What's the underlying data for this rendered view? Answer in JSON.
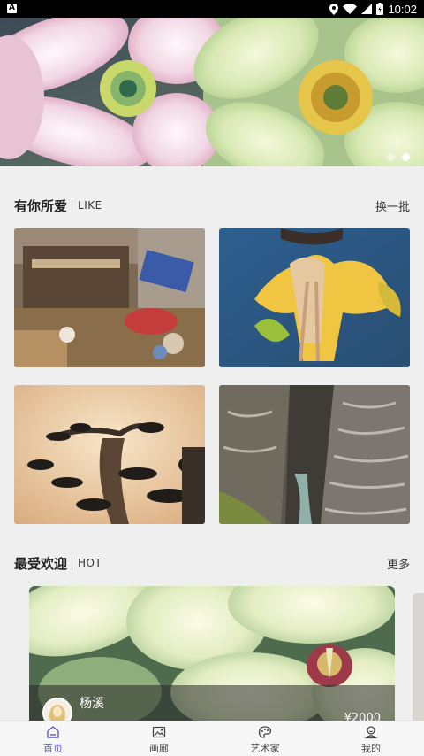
{
  "status_bar": {
    "time": "10:02",
    "app_icon_letter": "A",
    "icons": [
      "location-icon",
      "wifi-icon",
      "signal-icon",
      "battery-icon"
    ]
  },
  "banner": {
    "slide_count": 2,
    "active_slide": 2
  },
  "like_section": {
    "title": "有你所爱",
    "subtitle": "LIKE",
    "action": "换一批"
  },
  "hot_section": {
    "title": "最受欢迎",
    "subtitle": "HOT",
    "action": "更多"
  },
  "hot_card": {
    "artist_name": "杨溪",
    "price": "¥2000"
  },
  "tabbar": {
    "tabs": [
      {
        "label": "首页",
        "icon": "home-icon",
        "active": true
      },
      {
        "label": "画廊",
        "icon": "gallery-icon",
        "active": false
      },
      {
        "label": "艺术家",
        "icon": "artist-icon",
        "active": false
      },
      {
        "label": "我的",
        "icon": "profile-icon",
        "active": false
      }
    ]
  },
  "colors": {
    "accent": "#5b5bd6",
    "background": "#efefef"
  }
}
